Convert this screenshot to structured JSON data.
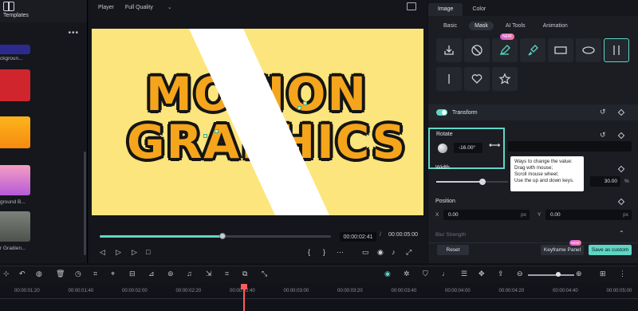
{
  "left_panel": {
    "title": "Templates",
    "more_label": "•••",
    "items": [
      {
        "label": "ckgroun...",
        "color": "#2d2a8e"
      },
      {
        "label": "",
        "color": "#d1252e"
      },
      {
        "label": "",
        "color": "#f9a21c"
      },
      {
        "label": "ground B...",
        "color": "#e070c8"
      },
      {
        "label": "r Gradien...",
        "color": "#6a6f67"
      }
    ]
  },
  "player": {
    "label": "Player",
    "quality": "Full Quality",
    "current_time": "00:00:02:41",
    "separator": "/",
    "total_time": "00:00:05:00",
    "progress_fraction": 0.53,
    "canvas_text_line1": "MOTION",
    "canvas_text_line2": "GRAPHICS"
  },
  "right_panel": {
    "tabs": [
      "Image",
      "Color"
    ],
    "subtabs": [
      "Basic",
      "Mask",
      "AI Tools",
      "Animation"
    ],
    "new_badge": "NEW",
    "transform_label": "Transform",
    "rotate_label": "Rotate",
    "rotate_value": "-16.00°",
    "width_label": "Width",
    "width_value": "30.00",
    "width_unit": "%",
    "width_fraction": 0.65,
    "position_label": "Position",
    "x_label": "X",
    "x_value": "0.00",
    "y_label": "Y",
    "y_value": "0.00",
    "px_unit": "px",
    "blur_label": "Blur Strength",
    "reset_label": "Reset",
    "keyframe_label": "Keyframe Panel",
    "keyframe_badge": "NEW",
    "save_label": "Save as custom"
  },
  "tooltip": {
    "line1": "Ways to change the value:",
    "line2": "Drag with mouse;",
    "line3": "Scroll mouse wheel;",
    "line4": "Use the up and down keys."
  },
  "timeline": {
    "ticks": [
      "00:00:01:20",
      "00:00:01:40",
      "00:00:02:00",
      "00:00:02:20",
      "00:00:02:40",
      "00:00:03:00",
      "00:00:03:20",
      "00:00:03:40",
      "00:00:04:00",
      "00:00:04:20",
      "00:00:04:40",
      "00:00:05:00"
    ]
  },
  "colors": {
    "accent": "#5fd6c5",
    "canvas_bg": "#fde57d",
    "text_orange": "#f5a51c",
    "playhead": "#ff5b5b"
  }
}
